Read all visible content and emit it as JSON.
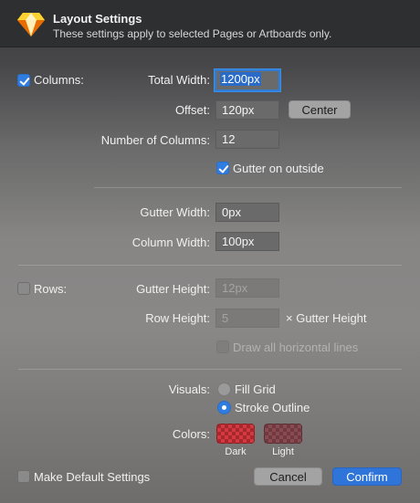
{
  "header": {
    "title": "Layout Settings",
    "subtitle": "These settings apply to selected Pages or Artboards only.",
    "app_icon": "sketch-diamond-icon"
  },
  "columns": {
    "label": "Columns:",
    "checked": true,
    "total_width_label": "Total Width:",
    "total_width_value": "1200px",
    "offset_label": "Offset:",
    "offset_value": "120px",
    "center_button": "Center",
    "number_label": "Number of Columns:",
    "number_value": "12",
    "gutter_outside_label": "Gutter on outside",
    "gutter_outside_checked": true,
    "gutter_width_label": "Gutter Width:",
    "gutter_width_value": "0px",
    "column_width_label": "Column Width:",
    "column_width_value": "100px"
  },
  "rows": {
    "label": "Rows:",
    "checked": false,
    "gutter_height_label": "Gutter Height:",
    "gutter_height_placeholder": "12px",
    "row_height_label": "Row Height:",
    "row_height_placeholder": "5",
    "row_height_suffix": "× Gutter Height",
    "draw_lines_label": "Draw all horizontal lines"
  },
  "visuals": {
    "label": "Visuals:",
    "fill_grid": "Fill Grid",
    "stroke_outline": "Stroke Outline",
    "selected": "stroke_outline"
  },
  "colors": {
    "label": "Colors:",
    "dark_caption": "Dark",
    "light_caption": "Light",
    "dark_color": "#c4323a",
    "light_color": "#7a4249"
  },
  "footer": {
    "default_label": "Make Default Settings",
    "cancel": "Cancel",
    "confirm": "Confirm"
  }
}
